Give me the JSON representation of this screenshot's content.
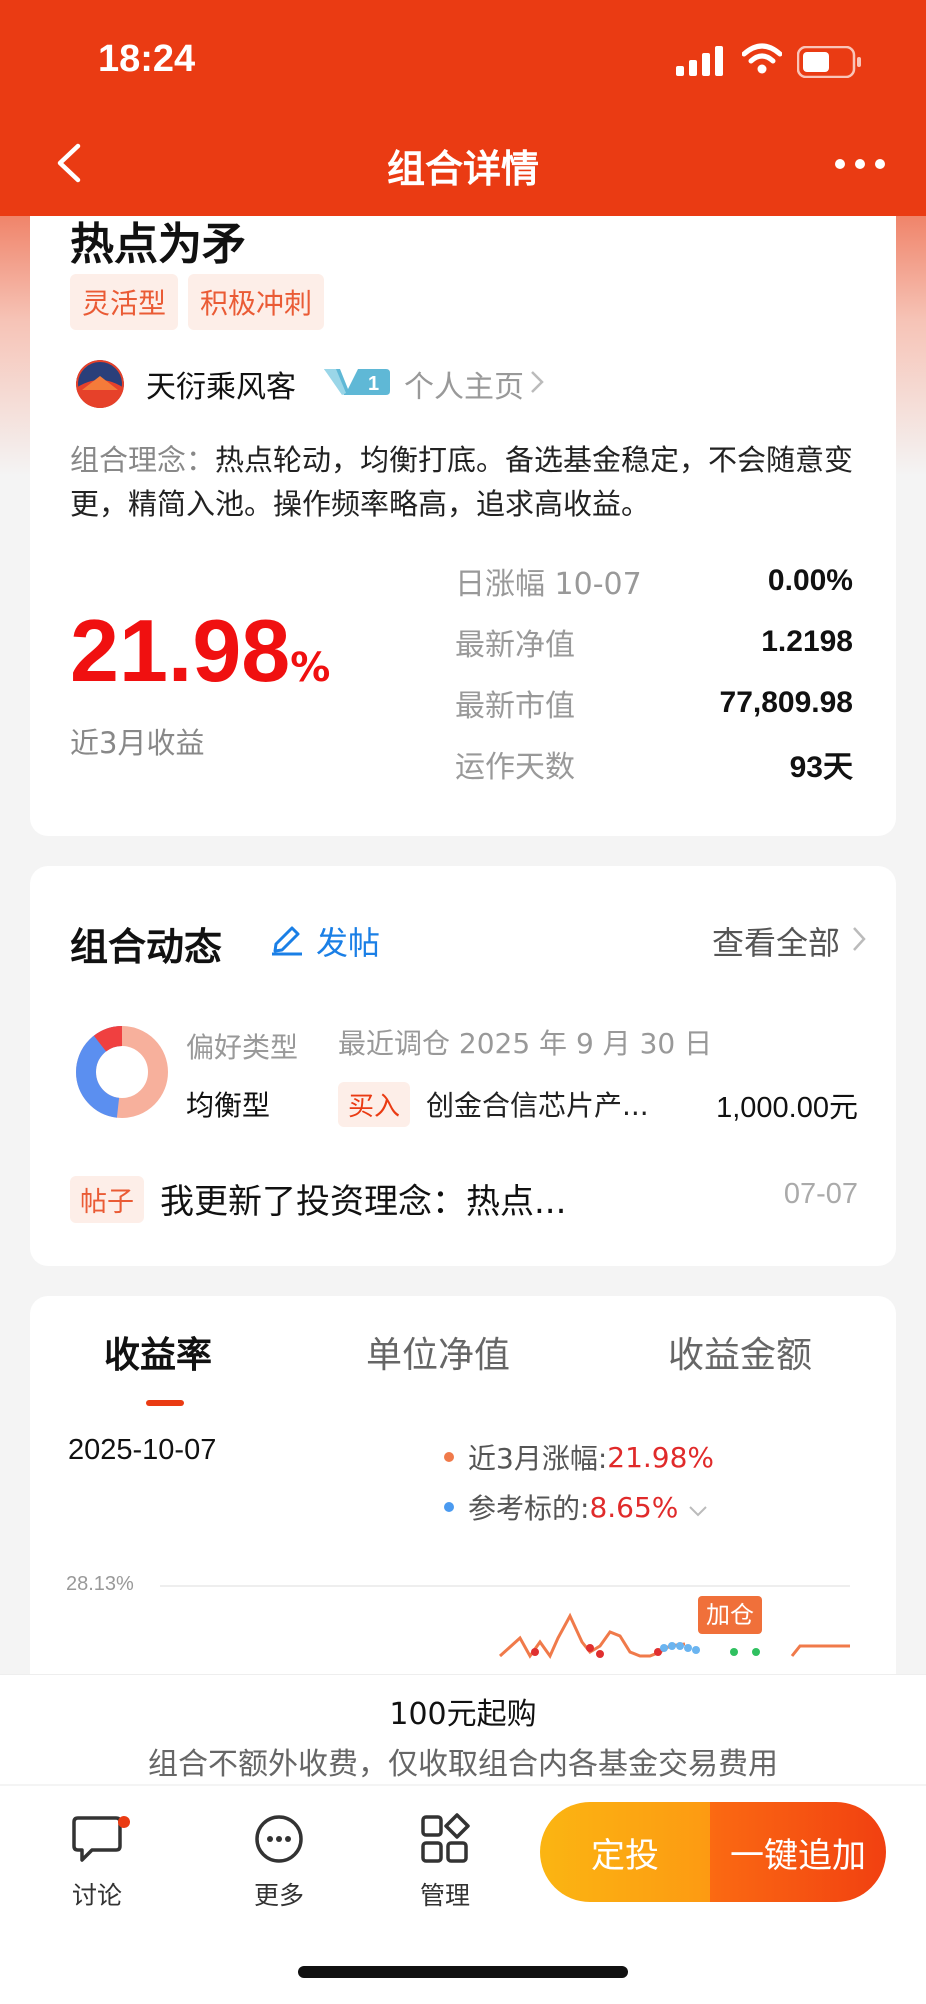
{
  "status_bar": {
    "time": "18:24"
  },
  "nav": {
    "title": "组合详情"
  },
  "combo": {
    "name": "热点为矛",
    "tags": [
      "灵活型",
      "积极冲刺"
    ],
    "author": "天衍乘风客",
    "vip_level": "1",
    "homepage_link": "个人主页",
    "philosophy_label": "组合理念：",
    "philosophy_text": "热点轮动，均衡打底。备选基金稳定，不会随意变更，精简入池。操作频率略高，追求高收益。",
    "return_value": "21.98",
    "return_unit": "%",
    "return_label": "近3月收益",
    "stats": [
      {
        "label": "日涨幅 10-07",
        "value": "0.00%"
      },
      {
        "label": "最新净值",
        "value": "1.2198"
      },
      {
        "label": "最新市值",
        "value": "77,809.98"
      },
      {
        "label": "运作天数",
        "value": "93天"
      }
    ]
  },
  "dynamics": {
    "title": "组合动态",
    "post_button": "发帖",
    "view_all": "查看全部",
    "pref_type_label": "偏好类型",
    "pref_type": "均衡型",
    "recent_adjust": "最近调仓 2025 年 9 月 30 日",
    "action_badge": "买入",
    "fund_name": "创金合信芯片产...",
    "amount": "1,000.00元",
    "post_tag": "帖子",
    "post_title": "我更新了投资理念：热点...",
    "post_date": "07-07"
  },
  "chart": {
    "tabs": [
      "收益率",
      "单位净值",
      "收益金额"
    ],
    "active_tab": 0,
    "date": "2025-10-07",
    "legend": [
      {
        "label": "近3月涨幅:",
        "value": "21.98%",
        "color": "#f07a4a"
      },
      {
        "label": "参考标的:",
        "value": "8.65%",
        "color": "#4a9af0"
      }
    ],
    "y_max_label": "28.13%",
    "annotation": "加仓"
  },
  "chart_data": {
    "type": "line",
    "title": "",
    "ylabel": "",
    "xlabel": "",
    "y_tick_labels": [
      "28.13%"
    ],
    "series": [
      {
        "name": "近3月涨幅",
        "values": [
          21.98
        ]
      },
      {
        "name": "参考标的",
        "values": [
          8.65
        ]
      }
    ]
  },
  "footer": {
    "notice_1": "100元起购",
    "notice_2": "组合不额外收费，仅收取组合内各基金交易费用",
    "items": [
      {
        "label": "讨论",
        "icon": "chat-icon"
      },
      {
        "label": "更多",
        "icon": "more-circle-icon"
      },
      {
        "label": "管理",
        "icon": "manage-grid-icon"
      }
    ],
    "cta_fixed": "定投",
    "cta_add": "一键追加"
  }
}
